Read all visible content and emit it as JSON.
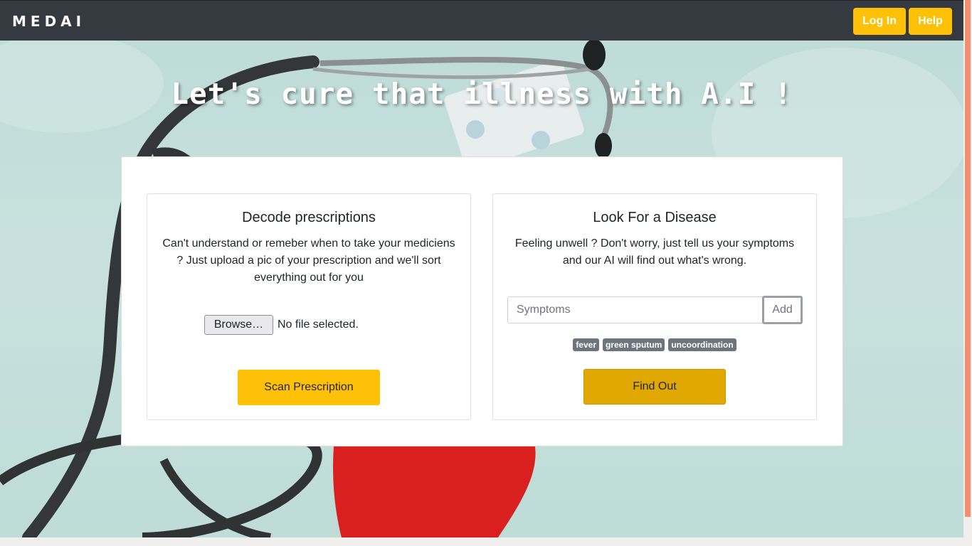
{
  "navbar": {
    "brand": "MEDAI",
    "login_label": "Log In",
    "help_label": "Help"
  },
  "hero": {
    "headline": "Let's cure that illness with A.I !"
  },
  "prescription_card": {
    "title": "Decode prescriptions",
    "description": "Can't understand or remeber when to take your mediciens ? Just upload a pic of your prescription and we'll sort everything out for you",
    "browse_label": "Browse…",
    "file_status": "No file selected.",
    "scan_label": "Scan Prescription"
  },
  "disease_card": {
    "title": "Look For a Disease",
    "description": "Feeling unwell ? Don't worry, just tell us your symptoms and our AI will find out what's wrong.",
    "input_placeholder": "Symptoms",
    "add_label": "Add",
    "symptoms": [
      "fever",
      "green sputum",
      "uncoordination"
    ],
    "find_label": "Find Out"
  },
  "colors": {
    "navbar": "#343a40",
    "accent": "#ffc107",
    "accent_active": "#e0a800",
    "tag": "#6c757d"
  }
}
